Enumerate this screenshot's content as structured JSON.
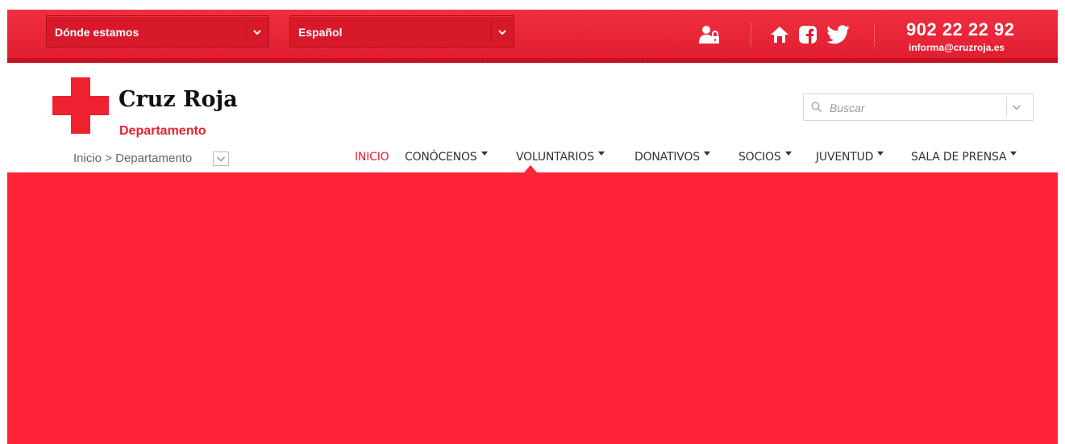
{
  "topbar": {
    "location_dropdown": "Dónde estamos",
    "language_dropdown": "Español",
    "phone": "902 22 22 92",
    "email": "informa@cruzroja.es",
    "icons": [
      "user-lock-icon",
      "home-icon",
      "facebook-icon",
      "twitter-icon"
    ]
  },
  "logo": {
    "title": "Cruz Roja",
    "subtitle": "Departamento"
  },
  "search": {
    "placeholder": "Buscar"
  },
  "breadcrumb": {
    "text": "Inicio > Departamento"
  },
  "nav": {
    "items": [
      {
        "label": "INICIO",
        "has_caret": false,
        "active": true
      },
      {
        "label": "CONÓCENOS",
        "has_caret": true,
        "active": false
      },
      {
        "label": "VOLUNTARIOS",
        "has_caret": true,
        "active": false
      },
      {
        "label": "DONATIVOS",
        "has_caret": true,
        "active": false
      },
      {
        "label": "SOCIOS",
        "has_caret": true,
        "active": false
      },
      {
        "label": "JUVENTUD",
        "has_caret": true,
        "active": false
      },
      {
        "label": "SALA DE PRENSA",
        "has_caret": true,
        "active": false
      }
    ]
  },
  "colors": {
    "brand_red": "#ee2131",
    "hero_red": "#ff2438",
    "topbar_red": "#e0192b",
    "nav_text": "#333333",
    "active_text": "#e8212e"
  }
}
